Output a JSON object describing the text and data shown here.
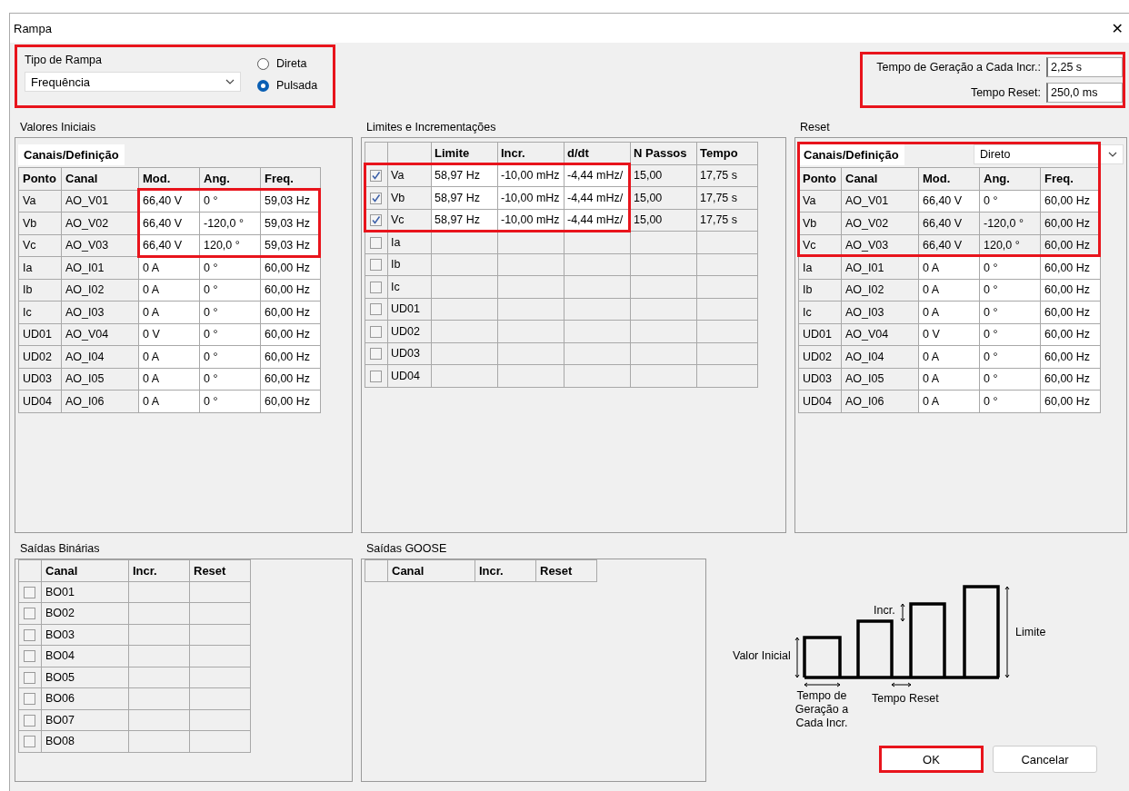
{
  "window": {
    "title": "Rampa",
    "close": "✕"
  },
  "ramp_type": {
    "label": "Tipo de Rampa",
    "value": "Frequência",
    "highlighted": true,
    "options": [
      {
        "label": "Direta",
        "selected": false
      },
      {
        "label": "Pulsada",
        "selected": true
      }
    ]
  },
  "timing": {
    "highlighted": true,
    "fields": [
      {
        "label": "Tempo de Geração a Cada Incr.:",
        "value": "2,25 s"
      },
      {
        "label": "Tempo Reset:",
        "value": "250,0 ms"
      }
    ]
  },
  "initial_values": {
    "title": "Valores Iniciais",
    "tab": {
      "label": "Canais/Definição",
      "selected": true
    },
    "highlighted": true,
    "columns": [
      {
        "label": "Ponto",
        "editable": false
      },
      {
        "label": "Canal",
        "editable": false
      },
      {
        "label": "Mod.",
        "editable": true
      },
      {
        "label": "Ang.",
        "editable": true
      },
      {
        "label": "Freq.",
        "editable": true
      }
    ],
    "rows": [
      {
        "cells": [
          "Va",
          "AO_V01",
          "66,40 V",
          "0 °",
          "59,03 Hz"
        ]
      },
      {
        "cells": [
          "Vb",
          "AO_V02",
          "66,40 V",
          "-120,0 °",
          "59,03 Hz"
        ]
      },
      {
        "cells": [
          "Vc",
          "AO_V03",
          "66,40 V",
          "120,0 °",
          "59,03 Hz"
        ]
      },
      {
        "cells": [
          "Ia",
          "AO_I01",
          "0 A",
          "0 °",
          "60,00 Hz"
        ]
      },
      {
        "cells": [
          "Ib",
          "AO_I02",
          "0 A",
          "0 °",
          "60,00 Hz"
        ]
      },
      {
        "cells": [
          "Ic",
          "AO_I03",
          "0 A",
          "0 °",
          "60,00 Hz"
        ]
      },
      {
        "cells": [
          "UD01",
          "AO_V04",
          "0 V",
          "0 °",
          "60,00 Hz"
        ]
      },
      {
        "cells": [
          "UD02",
          "AO_I04",
          "0 A",
          "0 °",
          "60,00 Hz"
        ]
      },
      {
        "cells": [
          "UD03",
          "AO_I05",
          "0 A",
          "0 °",
          "60,00 Hz"
        ]
      },
      {
        "cells": [
          "UD04",
          "AO_I06",
          "0 A",
          "0 °",
          "60,00 Hz"
        ]
      }
    ]
  },
  "limits": {
    "title": "Limites e Incrementações",
    "highlighted": true,
    "columns": [
      {
        "label": "Limite",
        "editable": true
      },
      {
        "label": "Incr.",
        "editable": true
      },
      {
        "label": "d/dt",
        "editable": true
      },
      {
        "label": "N Passos",
        "editable": false
      },
      {
        "label": "Tempo",
        "editable": false
      }
    ],
    "rows": [
      {
        "checked": true,
        "name": "Va",
        "cells": [
          "58,97 Hz",
          "-10,00 mHz",
          "-4,44 mHz/",
          "15,00",
          "17,75 s"
        ]
      },
      {
        "checked": true,
        "name": "Vb",
        "cells": [
          "58,97 Hz",
          "-10,00 mHz",
          "-4,44 mHz/",
          "15,00",
          "17,75 s"
        ]
      },
      {
        "checked": true,
        "name": "Vc",
        "cells": [
          "58,97 Hz",
          "-10,00 mHz",
          "-4,44 mHz/",
          "15,00",
          "17,75 s"
        ]
      },
      {
        "checked": false,
        "name": "Ia"
      },
      {
        "checked": false,
        "name": "Ib"
      },
      {
        "checked": false,
        "name": "Ic"
      },
      {
        "checked": false,
        "name": "UD01"
      },
      {
        "checked": false,
        "name": "UD02"
      },
      {
        "checked": false,
        "name": "UD03"
      },
      {
        "checked": false,
        "name": "UD04"
      }
    ]
  },
  "reset": {
    "title": "Reset",
    "tab": {
      "label": "Canais/Definição",
      "selected": true
    },
    "mode": "Direto",
    "highlighted": true,
    "columns": [
      {
        "label": "Ponto",
        "editable": false
      },
      {
        "label": "Canal",
        "editable": false
      },
      {
        "label": "Mod.",
        "editable": true
      },
      {
        "label": "Ang.",
        "editable": true
      },
      {
        "label": "Freq.",
        "editable": true
      }
    ],
    "rows": [
      {
        "locked": false,
        "cells": [
          "Va",
          "AO_V01",
          "66,40 V",
          "0 °",
          "60,00 Hz"
        ]
      },
      {
        "locked": true,
        "cells": [
          "Vb",
          "AO_V02",
          "66,40 V",
          "-120,0 °",
          "60,00 Hz"
        ]
      },
      {
        "locked": true,
        "cells": [
          "Vc",
          "AO_V03",
          "66,40 V",
          "120,0 °",
          "60,00 Hz"
        ]
      },
      {
        "locked": false,
        "cells": [
          "Ia",
          "AO_I01",
          "0 A",
          "0 °",
          "60,00 Hz"
        ]
      },
      {
        "locked": false,
        "cells": [
          "Ib",
          "AO_I02",
          "0 A",
          "0 °",
          "60,00 Hz"
        ]
      },
      {
        "locked": false,
        "cells": [
          "Ic",
          "AO_I03",
          "0 A",
          "0 °",
          "60,00 Hz"
        ]
      },
      {
        "locked": false,
        "cells": [
          "UD01",
          "AO_V04",
          "0 V",
          "0 °",
          "60,00 Hz"
        ]
      },
      {
        "locked": false,
        "cells": [
          "UD02",
          "AO_I04",
          "0 A",
          "0 °",
          "60,00 Hz"
        ]
      },
      {
        "locked": false,
        "cells": [
          "UD03",
          "AO_I05",
          "0 A",
          "0 °",
          "60,00 Hz"
        ]
      },
      {
        "locked": false,
        "cells": [
          "UD04",
          "AO_I06",
          "0 A",
          "0 °",
          "60,00 Hz"
        ]
      }
    ]
  },
  "binary_outputs": {
    "title": "Saídas Binárias",
    "columns": [
      "Canal",
      "Incr.",
      "Reset"
    ],
    "rows": [
      {
        "checked": false,
        "name": "BO01"
      },
      {
        "checked": false,
        "name": "BO02"
      },
      {
        "checked": false,
        "name": "BO03"
      },
      {
        "checked": false,
        "name": "BO04"
      },
      {
        "checked": false,
        "name": "BO05"
      },
      {
        "checked": false,
        "name": "BO06"
      },
      {
        "checked": false,
        "name": "BO07"
      },
      {
        "checked": false,
        "name": "BO08"
      }
    ]
  },
  "goose_outputs": {
    "title": "Saídas GOOSE",
    "columns": [
      "Canal",
      "Incr.",
      "Reset"
    ]
  },
  "diagram": {
    "initial": "Valor Inicial",
    "incr": "Incr.",
    "limit": "Limite",
    "gen_time": "Tempo de Geração a Cada Incr.",
    "reset_time": "Tempo Reset"
  },
  "buttons": [
    {
      "label": "OK",
      "highlighted": true
    },
    {
      "label": "Cancelar",
      "highlighted": false
    }
  ]
}
